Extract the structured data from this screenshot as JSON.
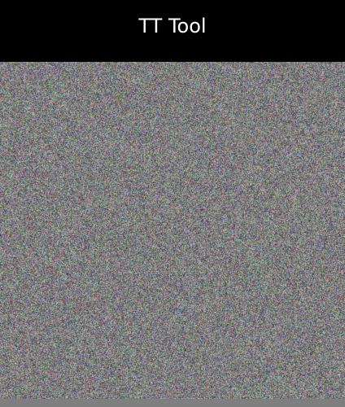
{
  "window": {
    "title": "TT Tool"
  },
  "colors": {
    "title_bar_background": "#000000",
    "title_text": "#ffffff",
    "noise_base": "#808080",
    "bottom_strip": "#7f7f7f"
  },
  "noise_area": {
    "description_icon": "random-noise-image"
  }
}
